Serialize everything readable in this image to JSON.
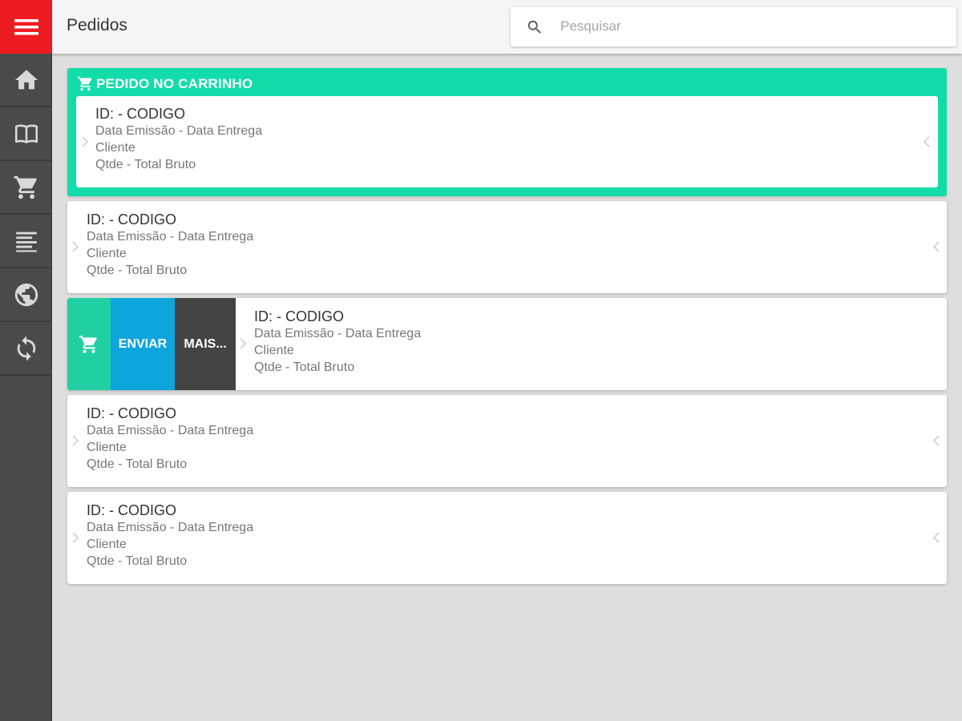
{
  "header": {
    "title": "Pedidos",
    "search_placeholder": "Pesquisar"
  },
  "sidebar": {
    "items": [
      {
        "icon": "menu-icon"
      },
      {
        "icon": "home-icon"
      },
      {
        "icon": "catalog-book-icon"
      },
      {
        "icon": "shopping-cart-icon"
      },
      {
        "icon": "list-lines-icon"
      },
      {
        "icon": "globe-icon"
      },
      {
        "icon": "sync-icon"
      }
    ]
  },
  "cart_section": {
    "label": "PEDIDO NO CARRINHO",
    "order": {
      "id": "ID: - CODIGO",
      "dates": "Data Emissão - Data Entrega",
      "client": "Cliente",
      "totals": "Qtde - Total Bruto"
    }
  },
  "orders": [
    {
      "id": "ID: - CODIGO",
      "dates": "Data Emissão - Data Entrega",
      "client": "Cliente",
      "totals": "Qtde - Total Bruto"
    },
    {
      "id": "ID: - CODIGO",
      "dates": "Data Emissão - Data Entrega",
      "client": "Cliente",
      "totals": "Qtde - Total Bruto"
    },
    {
      "id": "ID: - CODIGO",
      "dates": "Data Emissão - Data Entrega",
      "client": "Cliente",
      "totals": "Qtde - Total Bruto"
    },
    {
      "id": "ID: - CODIGO",
      "dates": "Data Emissão - Data Entrega",
      "client": "Cliente",
      "totals": "Qtde - Total Bruto"
    }
  ],
  "swipe_actions": {
    "send_label": "ENVIAR",
    "more_label": "MAIS..."
  },
  "colors": {
    "menu_red": "#ef1b23",
    "sidebar": "#4a4a4a",
    "cart_green": "#13dca9",
    "send_blue": "#0ea5dd",
    "more_dark": "#444444"
  }
}
